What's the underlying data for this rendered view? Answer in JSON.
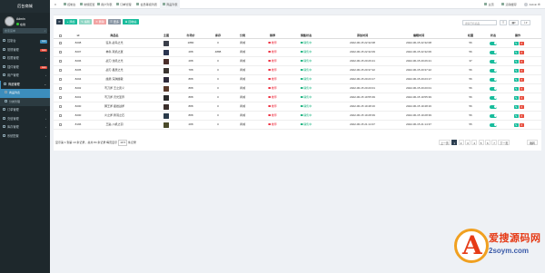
{
  "app": {
    "title": "后台商城"
  },
  "user": {
    "name": "Admin",
    "status": "在线"
  },
  "sidebar": {
    "search_placeholder": "搜索菜单",
    "items": [
      {
        "label": "控制台",
        "badge": "new",
        "badge_color": "#3c8dbc"
      },
      {
        "label": "常规管理",
        "badge": "new",
        "badge_color": "#e74c3c"
      },
      {
        "label": "权限管理"
      },
      {
        "label": "插件管理",
        "badge": "new",
        "badge_color": "#e74c3c"
      },
      {
        "label": "用户管理"
      },
      {
        "label": "商品管理",
        "open": true,
        "sub": [
          {
            "label": "商品列表",
            "active": true
          },
          {
            "label": "分类管理"
          }
        ]
      },
      {
        "label": "订单管理"
      },
      {
        "label": "充值管理"
      },
      {
        "label": "库存管理"
      },
      {
        "label": "系统配置"
      }
    ]
  },
  "topbar": {
    "tabs": [
      {
        "label": "控制台"
      },
      {
        "label": "常规配置"
      },
      {
        "label": "用户列表"
      },
      {
        "label": "订单管理"
      },
      {
        "label": "会员等级列表"
      },
      {
        "label": "商品列表",
        "active": true
      }
    ],
    "right": {
      "home": "主页",
      "clear": "清除缓存",
      "user": "Admin"
    }
  },
  "toolbar": {
    "refresh": "⟳",
    "add": "添加",
    "edit": "编辑",
    "delete": "删除",
    "more": "更多",
    "recycle": "回收站",
    "search_placeholder": "搜索已有商品"
  },
  "table": {
    "columns": [
      "id",
      "商品名",
      "主图",
      "市场价",
      "库存",
      "分类",
      "推荐",
      "销售状态",
      "添加时间",
      "编辑时间",
      "权重",
      "状态",
      "操作"
    ],
    "rows": [
      {
        "id": "8208",
        "name": "狂兵·战鸟之光",
        "price": "2880",
        "stock": "0",
        "cat": "商城",
        "rec": "推荐",
        "sale": "销售中",
        "added": "2022-06-15 22:32:08",
        "edited": "2022-06-15 22:32:08",
        "weight": "56",
        "thumb": "#3a3f4a"
      },
      {
        "id": "8207",
        "name": "神兵·冥焰之翼",
        "price": "288",
        "stock": "4888",
        "cat": "商城",
        "rec": "推荐",
        "sale": "销售中",
        "added": "2022-06-15 22:32:09",
        "edited": "2022-06-15 22:32:06",
        "weight": "56",
        "thumb": "#2a3550"
      },
      {
        "id": "8206",
        "name": "战刀·龙吼之光",
        "price": "288",
        "stock": "0",
        "cat": "商城",
        "rec": "推荐",
        "sale": "销售中",
        "added": "2022-06-15 20:26:21",
        "edited": "2022-06-15 20:26:21",
        "weight": "37",
        "thumb": "#4a2e2a"
      },
      {
        "id": "8205",
        "name": "战刃·星辰之光",
        "price": "788",
        "stock": "0",
        "cat": "商城",
        "rec": "推荐",
        "sale": "销售中",
        "added": "2022-06-15 20:37:22",
        "edited": "2022-06-15 20:37:22",
        "weight": "56",
        "thumb": "#3b3530"
      },
      {
        "id": "8204",
        "name": "魔盾·深渊魔裁",
        "price": "888",
        "stock": "0",
        "cat": "商城",
        "rec": "推荐",
        "sale": "销售中",
        "added": "2022-06-15 20:23:17",
        "edited": "2022-06-15 20:23:17",
        "weight": "56",
        "thumb": "#2e2a3a"
      },
      {
        "id": "8202",
        "name": "弯刀斧·王之武义",
        "price": "888",
        "stock": "0",
        "cat": "商城",
        "rec": "推荐",
        "sale": "销售中",
        "added": "2022-06-15 20:20:01",
        "edited": "2022-06-15 20:20:01",
        "weight": "56",
        "thumb": "#5a3a2a"
      },
      {
        "id": "8201",
        "name": "弯刀斧·灵光圣界",
        "price": "888",
        "stock": "0",
        "cat": "商城",
        "rec": "推荐",
        "sale": "销售中",
        "added": "2022-06-15 19:55:39",
        "edited": "2022-06-15 19:55:39",
        "weight": "56",
        "thumb": "#2a2a2a"
      },
      {
        "id": "8200",
        "name": "狮王斧·星岩战斧",
        "price": "888",
        "stock": "0",
        "cat": "商城",
        "rec": "推荐",
        "sale": "销售中",
        "added": "2022-06-15 19:48:16",
        "edited": "2022-06-15 19:48:16",
        "weight": "56",
        "thumb": "#3a2e2a"
      },
      {
        "id": "8200",
        "name": "炎之斧·鸦羽之石",
        "price": "888",
        "stock": "0",
        "cat": "商城",
        "rec": "推荐",
        "sale": "销售中",
        "added": "2022-06-15 19:28:39",
        "edited": "2022-06-15 19:28:39",
        "weight": "56",
        "thumb": "#2a3a4a"
      },
      {
        "id": "8196",
        "name": "王匙·川机之羽",
        "price": "288",
        "stock": "0",
        "cat": "商城",
        "rec": "推荐",
        "sale": "销售中",
        "added": "2022-06-15 21:14:37",
        "edited": "2022-06-15 21:14:37",
        "weight": "55",
        "thumb": "#4a4a2a"
      }
    ]
  },
  "footer": {
    "summary": "显示第 1 到第 10 条记录，总共 84 条记录 每页显示",
    "page_size": "10 ▾",
    "summary_tail": "条记录"
  },
  "pager": {
    "prev": "上一页",
    "pages": [
      "1",
      "2",
      "3",
      "4",
      "5",
      "6",
      "7"
    ],
    "next": "下一页",
    "goto": "跳转"
  },
  "watermark": {
    "letter": "A",
    "line1": "爱搜源码网",
    "line2": "2soym.com"
  }
}
